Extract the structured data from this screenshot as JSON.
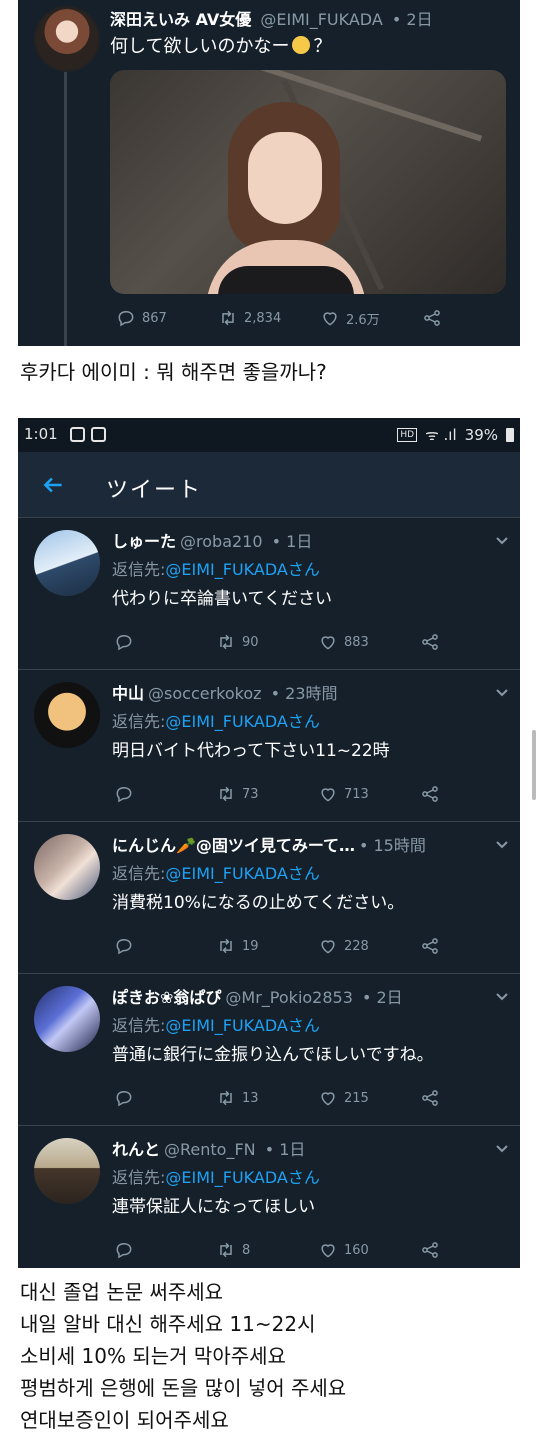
{
  "top_tweet": {
    "name": "深田えいみ AV女優",
    "handle": "@EIMI_FUKADA",
    "time": "2日",
    "text_before": "何して欲しいのかなー",
    "text_after": "？",
    "emoji": "smiling-face",
    "actions": {
      "replies": "867",
      "retweets": "2,834",
      "likes": "2.6万"
    }
  },
  "caption_top": "후카다 에이미 : 뭐 해주면 좋을까나?",
  "phone": {
    "status": {
      "time": "1:01",
      "battery": "39%"
    },
    "title": "ツイート",
    "replies": [
      {
        "name": "しゅーた",
        "handle": "@roba210",
        "time": "1日",
        "reply_label": "返信先:",
        "mention": "@EIMI_FUKADAさん",
        "text": "代わりに卒論書いてください",
        "retweets": "90",
        "likes": "883"
      },
      {
        "name": "中山",
        "handle": "@soccerkokoz",
        "time": "23時間",
        "reply_label": "返信先:",
        "mention": "@EIMI_FUKADAさん",
        "text": "明日バイト代わって下さい11~22時",
        "retweets": "73",
        "likes": "713"
      },
      {
        "name": "にんじん🥕@固ツイ見てみーて…",
        "handle": "",
        "time": "15時間",
        "reply_label": "返信先:",
        "mention": "@EIMI_FUKADAさん",
        "text": "消費税10%になるの止めてください。",
        "retweets": "19",
        "likes": "228"
      },
      {
        "name": "ぽきお❀翁ぱぴ",
        "handle": "@Mr_Pokio2853",
        "time": "2日",
        "reply_label": "返信先:",
        "mention": "@EIMI_FUKADAさん",
        "text": "普通に銀行に金振り込んでほしいですね。",
        "retweets": "13",
        "likes": "215"
      },
      {
        "name": "れんと",
        "handle": "@Rento_FN",
        "time": "1日",
        "reply_label": "返信先:",
        "mention": "@EIMI_FUKADAさん",
        "text": "連帯保証人になってほしい",
        "retweets": "8",
        "likes": "160"
      }
    ]
  },
  "captions_bottom": [
    "대신 졸업 논문 써주세요",
    "내일 알바 대신 해주세요 11~22시",
    "소비세 10% 되는거 막아주세요",
    "평범하게 은행에 돈을 많이 넣어 주세요",
    "연대보증인이 되어주세요"
  ]
}
